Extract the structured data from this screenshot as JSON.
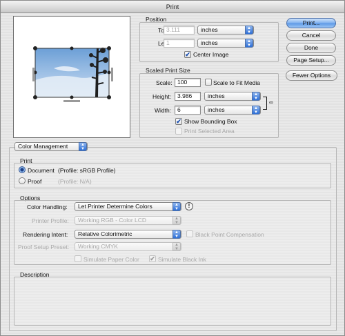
{
  "window": {
    "title": "Print"
  },
  "position": {
    "legend": "Position",
    "top_label": "Top:",
    "top_value": "3.111",
    "top_unit": "inches",
    "left_label": "Left:",
    "left_value": "1",
    "left_unit": "inches",
    "center_image_label": "Center Image",
    "center_image_checked": true
  },
  "scaled": {
    "legend": "Scaled Print Size",
    "scale_label": "Scale:",
    "scale_value": "100",
    "scale_to_fit_label": "Scale to Fit Media",
    "height_label": "Height:",
    "height_value": "3.986",
    "height_unit": "inches",
    "width_label": "Width:",
    "width_value": "6",
    "width_unit": "inches",
    "show_bounding_box_label": "Show Bounding Box",
    "print_selected_area_label": "Print Selected Area"
  },
  "buttons": {
    "print": "Print...",
    "cancel": "Cancel",
    "done": "Done",
    "page_setup": "Page Setup...",
    "fewer_options": "Fewer Options"
  },
  "color_management_menu": "Color Management",
  "print_group": {
    "legend": "Print",
    "document_label": "Document",
    "document_profile": "(Profile: sRGB Profile)",
    "proof_label": "Proof",
    "proof_profile": "(Profile: N/A)"
  },
  "options": {
    "legend": "Options",
    "color_handling_label": "Color Handling:",
    "color_handling_value": "Let Printer Determine Colors",
    "printer_profile_label": "Printer Profile:",
    "printer_profile_value": "Working RGB - Color LCD",
    "rendering_intent_label": "Rendering Intent:",
    "rendering_intent_value": "Relative Colorimetric",
    "black_point_label": "Black Point Compensation",
    "proof_setup_label": "Proof Setup Preset:",
    "proof_setup_value": "Working CMYK",
    "simulate_paper_label": "Simulate Paper Color",
    "simulate_ink_label": "Simulate Black Ink"
  },
  "description": {
    "legend": "Description"
  },
  "icons": {
    "checkmark": "✔",
    "popup_arrows": "▲▼",
    "link": "🔗",
    "warning": "!"
  }
}
